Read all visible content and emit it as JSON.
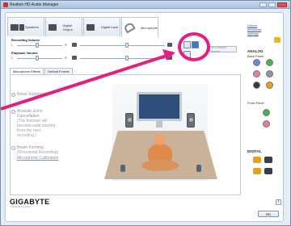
{
  "window": {
    "title": "Realtek HD Audio Manager"
  },
  "device_tabs": [
    {
      "label": "Speakers"
    },
    {
      "label": "Digital Output"
    },
    {
      "label": "Digital Input"
    },
    {
      "label": "Microphone"
    }
  ],
  "top_right": {
    "link": "Device advanced settings"
  },
  "volume": {
    "recording_title": "Recording Volume",
    "playback_title": "Playback Volume",
    "left_label": "L",
    "right_label": "R",
    "recording_level": 0.55,
    "playback_level": 0.55
  },
  "set_default_label": "Set Default Device",
  "effect_tabs": [
    {
      "label": "Microphone Effects"
    },
    {
      "label": "Default Format"
    }
  ],
  "effects": {
    "noise_suppression": "Noise Suppression",
    "aec": "Acoustic Echo Cancellation",
    "aec_desc": "(The function will become valid starting from the next recording.)",
    "beam": "Beam Forming",
    "beam_desc": "(Directional Recording)",
    "calibration": "Microphone Calibration"
  },
  "right_panel": {
    "analog": "ANALOG",
    "back_panel": "Back Panel",
    "front_panel": "Front Panel",
    "digital": "DIGITAL"
  },
  "colors": {
    "annotation": "#e2207f",
    "jack_blue": "#6a8bd6",
    "jack_green": "#4caf50",
    "jack_pink": "#e87aa8",
    "jack_gray": "#8f959c",
    "jack_black": "#3a3a3a",
    "jack_orange": "#e6a21f"
  },
  "footer": {
    "logo": "GIGABYTE",
    "logo_sub": "TECHNOLOGY",
    "info": "i",
    "ok": "OK"
  }
}
